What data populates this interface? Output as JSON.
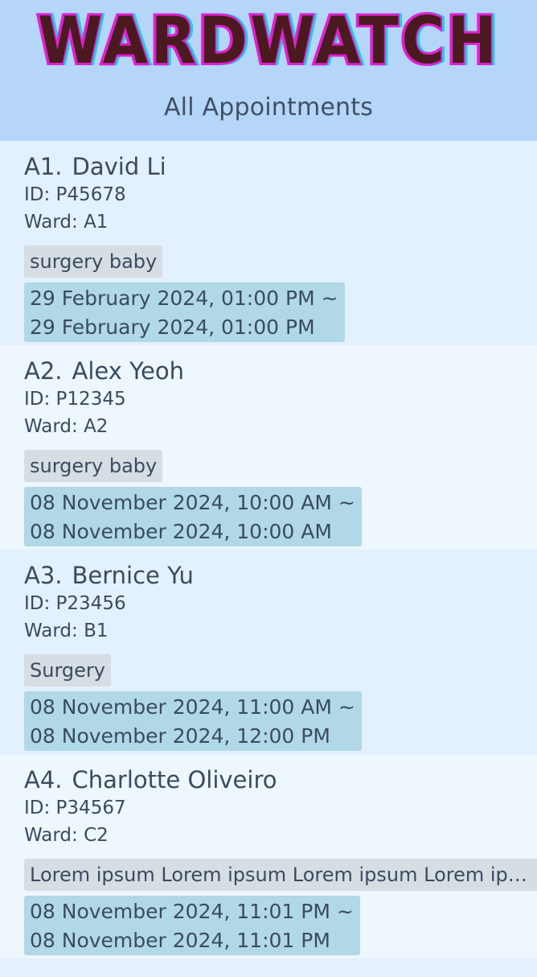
{
  "app": {
    "logo_text": "WARDWATCH",
    "subtitle": "All Appointments"
  },
  "appointments": [
    {
      "index": "A1.",
      "name": "David Li",
      "id_line": "ID: P45678",
      "ward_line": "Ward: A1",
      "tag": "surgery baby",
      "time_start": "29 February 2024, 01:00 PM ~",
      "time_end": "29 February 2024, 01:00 PM"
    },
    {
      "index": "A2.",
      "name": "Alex Yeoh",
      "id_line": "ID: P12345",
      "ward_line": "Ward: A2",
      "tag": "surgery baby",
      "time_start": "08 November 2024, 10:00 AM ~",
      "time_end": "08 November 2024, 10:00 AM"
    },
    {
      "index": "A3.",
      "name": "Bernice Yu",
      "id_line": "ID: P23456",
      "ward_line": "Ward: B1",
      "tag": "Surgery",
      "time_start": "08 November 2024, 11:00 AM ~",
      "time_end": "08 November 2024, 12:00 PM"
    },
    {
      "index": "A4.",
      "name": "Charlotte Oliveiro",
      "id_line": "ID: P34567",
      "ward_line": "Ward: C2",
      "tag": "Lorem ipsum Lorem ipsum Lorem ipsum Lorem ipsu...",
      "time_start": "08 November 2024, 11:01 PM ~",
      "time_end": "08 November 2024, 11:01 PM"
    }
  ],
  "colors": {
    "header_bg": "#b5d6f8",
    "card_odd": "#e3f0fd",
    "card_even": "#eef6fe",
    "tag_bg": "#d6dde3",
    "time_bg": "#b1d8e6",
    "logo_fill": "#4a1a20",
    "logo_outline_pink": "#e020d0",
    "logo_outline_cyan": "#20d0e0"
  }
}
